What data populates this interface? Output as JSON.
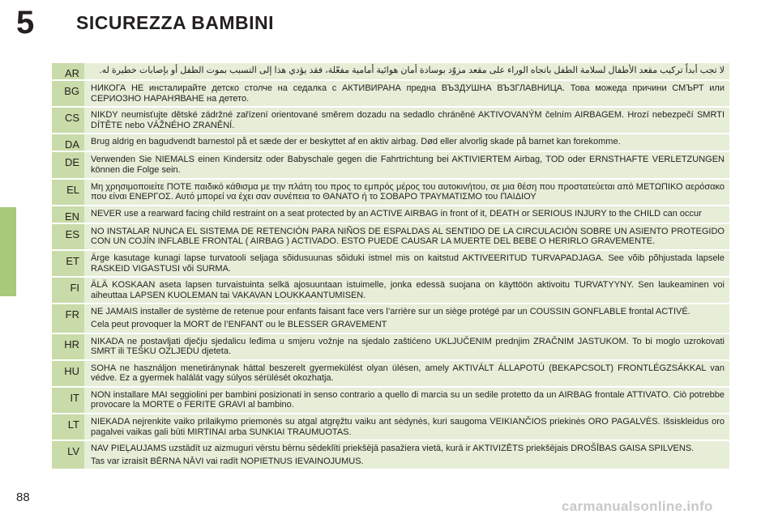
{
  "header": {
    "chapter_number": "5",
    "title": "SICUREZZA BAMBINI"
  },
  "rows": [
    {
      "code": "AR",
      "lines": [
        "لا تجب أبداً تركيب مقعد الأطفال لسلامة الطفل باتجاه الوراء على مقعد مزوّد بوسادة أمان هوائية أمامية مفعّلة، فقد يؤدي هذا إلى التسبب بموت الطفل أو بإصابات خطيرة له."
      ]
    },
    {
      "code": "BG",
      "lines": [
        "НИКОГА НЕ инсталирайте детско столче на седалка с АКТИВИРАНА предна ВЪЗДУШНА ВЪЗГЛАВНИЦА. Това можеда причини СМЪРТ или СЕРИОЗНО НАРАНЯВАНЕ на детето."
      ]
    },
    {
      "code": "CS",
      "lines": [
        "NIKDY neumisťujte dětské zádržné zařízení orientované směrem dozadu na sedadlo chráněné AKTIVOVANÝM čelním AIRBAGEM. Hrozí nebezpečí SMRTI DÍTĚTE nebo VÁŽNÉHO ZRANĚNÍ."
      ]
    },
    {
      "code": "DA",
      "lines": [
        "Brug aldrig en bagudvendt barnestol på et sæde der er beskyttet af en aktiv airbag. Død eller alvorlig skade på barnet kan forekomme."
      ]
    },
    {
      "code": "DE",
      "lines": [
        "Verwenden Sie NIEMALS einen Kindersitz oder Babyschale gegen die Fahrtrichtung bei AKTIVIERTEM Airbag, TOD oder ERNSTHAFTE VERLETZUNGEN können die Folge sein."
      ]
    },
    {
      "code": "EL",
      "lines": [
        "Μη χρησιμοποιείτε ΠΟΤΕ παιδικό κάθισμα με την πλάτη του προς το εμπρός μέρος του αυτοκινήτου, σε μια θέση που προστατεύεται από ΜΕΤΩΠΙΚΟ αερόσακο που είναι ΕΝΕΡΓΟΣ. Αυτό μπορεί να έχει σαν συνέπεια το ΘΑΝΑΤΟ ή το ΣΟΒΑΡΟ ΤΡΑΥΜΑΤΙΣΜΟ του ΠΑΙΔΙΟΥ"
      ]
    },
    {
      "code": "EN",
      "lines": [
        "NEVER use a rearward facing child restraint on a seat protected by an ACTIVE AIRBAG in front of it, DEATH or SERIOUS INJURY to the CHILD can occur"
      ]
    },
    {
      "code": "ES",
      "lines": [
        "NO INSTALAR NUNCA EL SISTEMA DE RETENCIÓN PARA NIÑOS DE ESPALDAS AL SENTIDO DE LA CIRCULACIÓN SOBRE UN ASIENTO PROTEGIDO CON UN COJÍN INFLABLE FRONTAL ( AIRBAG ) ACTIVADO. ESTO PUEDE CAUSAR LA MUERTE DEL BEBE O HERIRLO GRAVEMENTE."
      ]
    },
    {
      "code": "ET",
      "lines": [
        "Ärge kasutage kunagi lapse turvatooli seljaga sõidusuunas sõiduki istmel mis on kaitstud AKTIVEERITUD TURVAPADJAGA. See võib põhjustada lapsele RASKEID VIGASTUSI või SURMA."
      ]
    },
    {
      "code": "FI",
      "lines": [
        "ÄLÄ KOSKAAN aseta lapsen turvaistuinta selkä ajosuuntaan istuimelle, jonka edessä suojana on käyttöön aktivoitu TURVATYYNY. Sen laukeaminen voi aiheuttaa LAPSEN KUOLEMAN tai VAKAVAN LOUKKAANTUMISEN."
      ]
    },
    {
      "code": "FR",
      "lines": [
        "NE JAMAIS installer de système de retenue pour enfants faisant face vers l’arrière sur un siège protégé par un COUSSIN GONFLABLE frontal ACTIVÉ.",
        "Cela peut provoquer la MORT de l’ENFANT ou le BLESSER GRAVEMENT"
      ]
    },
    {
      "code": "HR",
      "lines": [
        "NIKADA ne postavljati dječju sjedalicu leđima u smjeru vožnje na sjedalo zaštićeno UKLJUČENIM prednjim ZRAČNIM JASTUKOM. To bi moglo uzrokovati SMRT ili TEŠKU OZLJEDU djeteta."
      ]
    },
    {
      "code": "HU",
      "lines": [
        "SOHA ne használjon menetiránynak háttal beszerelt gyermekülést olyan ülésen, amely AKTIVÁLT ÁLLAPOTÚ (BEKAPCSOLT) FRONTLÉGZSÁKKAL van védve. Ez a gyermek halálát vagy súlyos sérülését okozhatja."
      ]
    },
    {
      "code": "IT",
      "lines": [
        "NON installare MAI seggiolini per bambini posizionati in senso contrario a quello di marcia su un sedile protetto da un AIRBAG frontale ATTIVATO. Ciò potrebbe provocare la MORTE o FERITE GRAVI al bambino."
      ]
    },
    {
      "code": "LT",
      "lines": [
        "NIEKADA nejrenkite vaiko prilaikymo priemonės su atgal atgręžtu vaiku ant sėdynės, kuri saugoma VEIKIANČIOS priekinės ORO PAGALVĖS. Išsiskleidus oro pagalvei vaikas gali būti MIRTINAI arba SUNKIAI TRAUMUOTAS."
      ]
    },
    {
      "code": "LV",
      "lines": [
        "NAV PIEĻAUJAMS uzstādīt uz aizmuguri vērstu bērnu sēdeklīti priekšējā pasažiera  vietā, kurā ir AKTIVIZĒTS priekšējais DROŠĪBAS GAISA SPILVENS.",
        "Tas var izraisīt BĒRNA NĀVI vai radīt NOPIETNUS IEVAINOJUMUS."
      ]
    }
  ],
  "footer": {
    "page_number": "88",
    "watermark": "carmanualsonline.info"
  },
  "colors": {
    "code_bg": "#c9dba8",
    "text_bg": "#e6eed8",
    "tab": "#a8c87a"
  }
}
